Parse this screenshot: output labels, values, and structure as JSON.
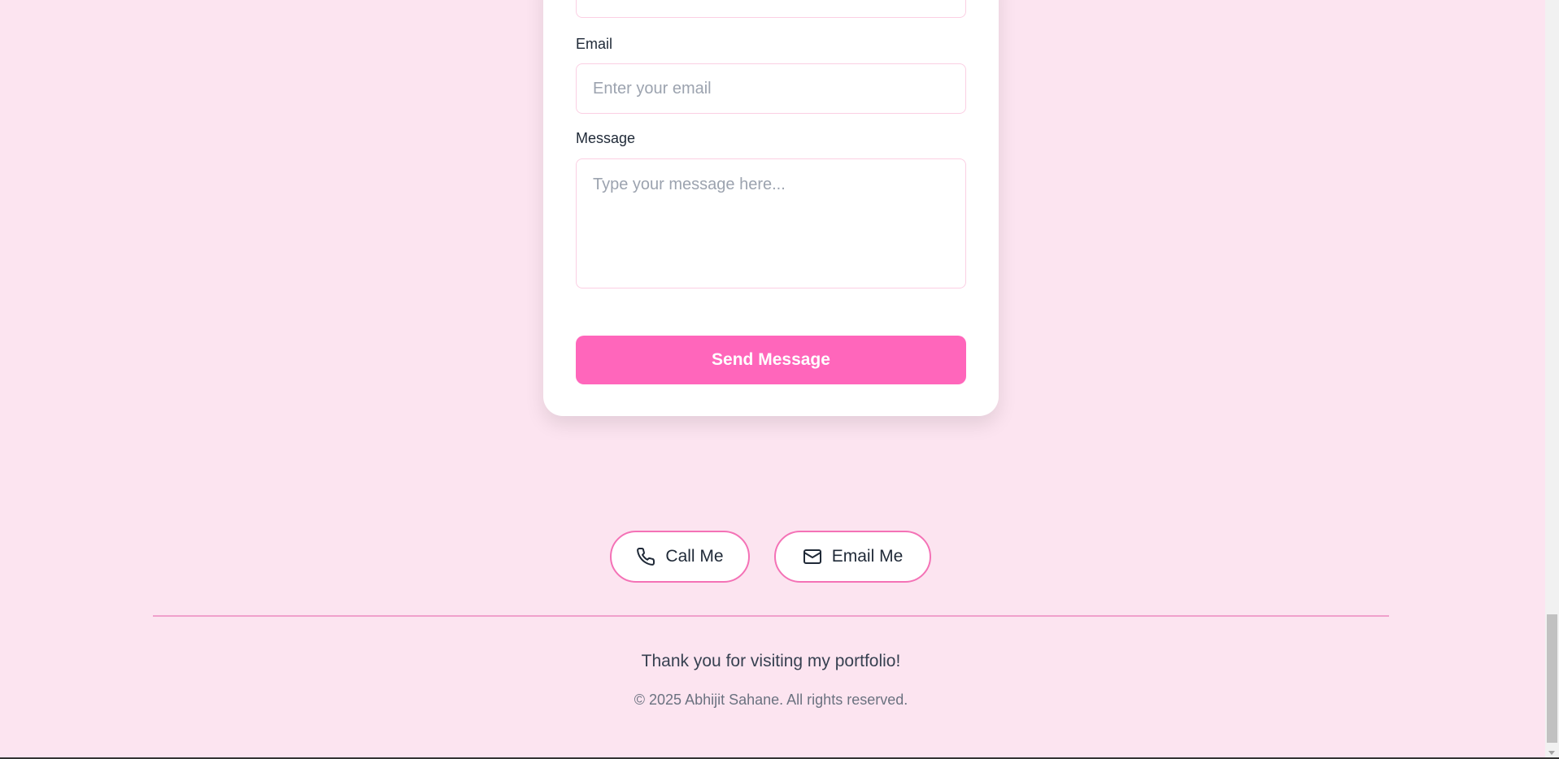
{
  "contact_form": {
    "email_label": "Email",
    "email_placeholder": "Enter your email",
    "message_label": "Message",
    "message_placeholder": "Type your message here...",
    "submit_label": "Send Message"
  },
  "contact_links": {
    "call_label": "Call Me",
    "call_icon": "phone-icon",
    "email_label": "Email Me",
    "email_icon": "mail-icon"
  },
  "footer": {
    "thanks": "Thank you for visiting my portfolio!",
    "copyright": "© 2025 Abhijit Sahane. All rights reserved."
  },
  "colors": {
    "background": "#fce4f0",
    "accent": "#ff66bb",
    "border": "#f472b6"
  }
}
